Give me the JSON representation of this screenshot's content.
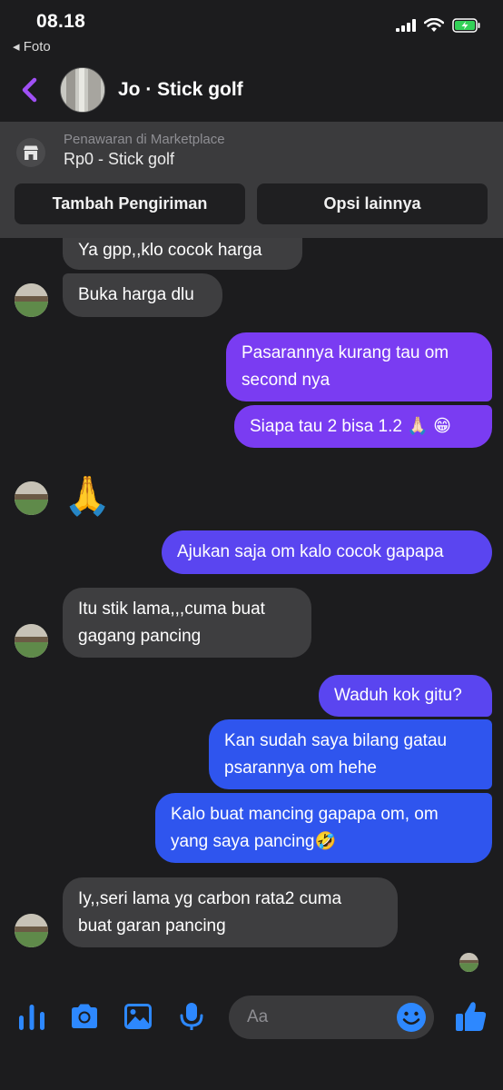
{
  "status": {
    "time": "08.18",
    "back_app": "◂ Foto"
  },
  "header": {
    "title": "Jo · Stick golf"
  },
  "banner": {
    "label": "Penawaran di Marketplace",
    "item": "Rp0 - Stick golf",
    "btn_shipping": "Tambah Pengiriman",
    "btn_options": "Opsi lainnya"
  },
  "messages": [
    {
      "from": "them",
      "text": "Ya gpp,,klo cocok harga"
    },
    {
      "from": "them",
      "text": "Buka harga dlu"
    },
    {
      "from": "me",
      "text": "Pasarannya kurang tau om\nsecond nya"
    },
    {
      "from": "me",
      "text": "Siapa tau 2 bisa 1.2 🙏🏻 😁"
    },
    {
      "from": "them",
      "text": "🙏"
    },
    {
      "from": "me",
      "text": "Ajukan saja om kalo cocok gapapa"
    },
    {
      "from": "them",
      "text": "Itu stik lama,,,cuma buat\ngagang pancing"
    },
    {
      "from": "me",
      "text": "Waduh kok gitu?"
    },
    {
      "from": "me",
      "text": "Kan sudah saya bilang gatau\npsarannya om hehe"
    },
    {
      "from": "me",
      "text": "Kalo buat mancing gapapa om, om\nyang saya pancing🤣"
    },
    {
      "from": "them",
      "text": "Iy,,seri lama yg carbon rata2 cuma\nbuat garan pancing"
    }
  ],
  "composer": {
    "placeholder": "Aa"
  },
  "colors": {
    "accent": "#2d88ff",
    "back": "#a050f5",
    "bubble_in": "#3e3e40",
    "bubble_out_top": "#7a3cf2",
    "bubble_out_bottom": "#2f55ee"
  }
}
